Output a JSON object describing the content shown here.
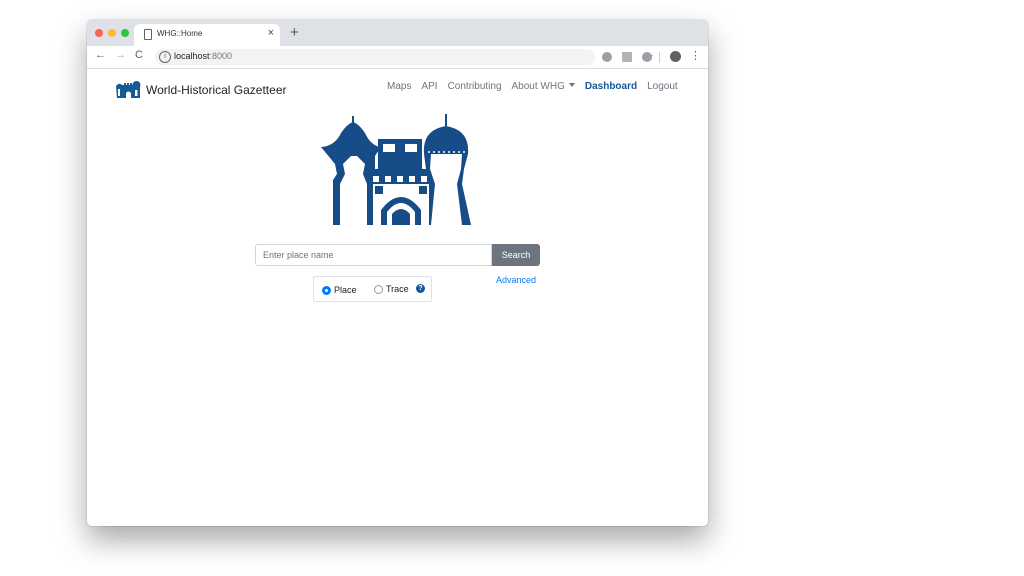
{
  "browser": {
    "tab_title": "WHG::Home",
    "tab_close": "×",
    "new_tab": "+",
    "url_host": "localhost",
    "url_port": ":8000",
    "icons": {
      "back": "←",
      "forward": "→",
      "reload": "C",
      "info": "i",
      "star": "☆",
      "menu": "⋮"
    },
    "traffic_colors": [
      "#fe5f57",
      "#febc2e",
      "#28c840"
    ]
  },
  "site": {
    "brand_name": "World-Historical Gazetteer",
    "nav": {
      "maps": "Maps",
      "api": "API",
      "contributing": "Contributing",
      "about": "About WHG",
      "dashboard": "Dashboard",
      "logout": "Logout"
    },
    "accent_color": "#155a96"
  },
  "search": {
    "placeholder": "Enter place name",
    "button": "Search",
    "advanced": "Advanced",
    "options": {
      "place": "Place",
      "trace": "Trace"
    },
    "selected": "Place",
    "help_icon": "?"
  }
}
